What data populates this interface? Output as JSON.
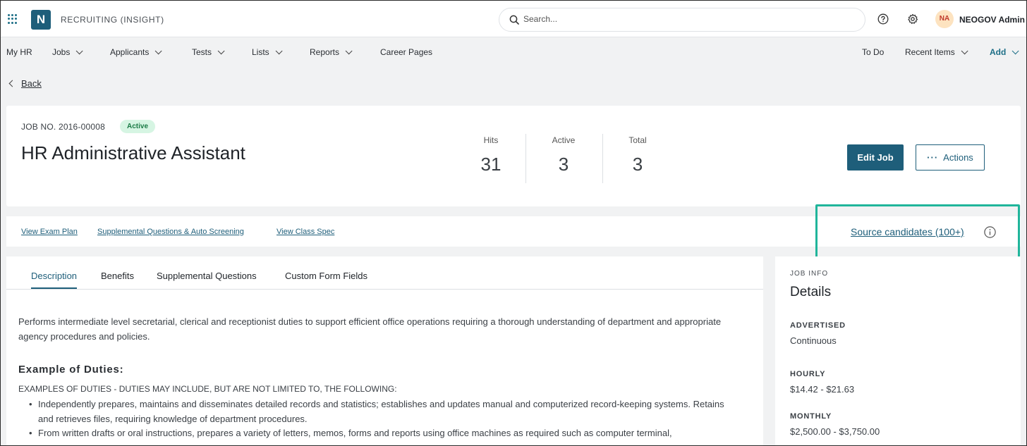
{
  "topbar": {
    "app_title": "RECRUITING (INSIGHT)",
    "logo_letter": "N",
    "search_placeholder": "Search...",
    "user_initials": "NA",
    "user_name": "NEOGOV Admin"
  },
  "nav": {
    "left": [
      {
        "label": "My HR",
        "dropdown": false
      },
      {
        "label": "Jobs",
        "dropdown": true
      },
      {
        "label": "Applicants",
        "dropdown": true
      },
      {
        "label": "Tests",
        "dropdown": true
      },
      {
        "label": "Lists",
        "dropdown": true
      },
      {
        "label": "Reports",
        "dropdown": true
      },
      {
        "label": "Career Pages",
        "dropdown": false
      }
    ],
    "right": [
      {
        "label": "To Do",
        "dropdown": false
      },
      {
        "label": "Recent Items",
        "dropdown": true
      },
      {
        "label": "Add",
        "dropdown": true
      }
    ]
  },
  "back_label": "Back",
  "job": {
    "number": "JOB NO. 2016-00008",
    "status": "Active",
    "title": "HR Administrative Assistant",
    "stats": [
      {
        "label": "Hits",
        "value": "31"
      },
      {
        "label": "Active",
        "value": "3"
      },
      {
        "label": "Total",
        "value": "3"
      }
    ],
    "edit_label": "Edit Job",
    "actions_label": "Actions"
  },
  "links": {
    "exam_plan": "View Exam Plan",
    "supplemental": "Supplemental Questions & Auto Screening",
    "class_spec": "View Class Spec",
    "source": "Source candidates (100+)"
  },
  "tabs": [
    "Description",
    "Benefits",
    "Supplemental Questions",
    "Custom Form Fields"
  ],
  "description": {
    "summary": "Performs intermediate level secretarial, clerical and receptionist duties to support efficient office operations requiring a thorough understanding of department and appropriate agency procedures and policies.",
    "section_title": "Example of Duties:",
    "duties_intro": "EXAMPLES OF DUTIES - DUTIES MAY INCLUDE, BUT ARE NOT LIMITED TO, THE FOLLOWING:",
    "duties": [
      "Independently prepares, maintains and disseminates detailed records and statistics; establishes and updates manual and computerized record-keeping systems. Retains and retrieves files, requiring knowledge of department procedures.",
      "From written drafts or oral instructions, prepares a variety of letters, memos, forms and reports using office machines as required such as computer terminal,"
    ]
  },
  "job_info": {
    "eyebrow": "JOB INFO",
    "title": "Details",
    "fields": [
      {
        "key": "ADVERTISED",
        "value": "Continuous"
      },
      {
        "key": "HOURLY",
        "value": "$14.42 - $21.63"
      },
      {
        "key": "MONTHLY",
        "value": "$2,500.00 - $3,750.00"
      }
    ]
  },
  "colors": {
    "brand": "#1e5e7a",
    "highlight": "#20b59b",
    "active_badge_bg": "#d6f5e3"
  }
}
